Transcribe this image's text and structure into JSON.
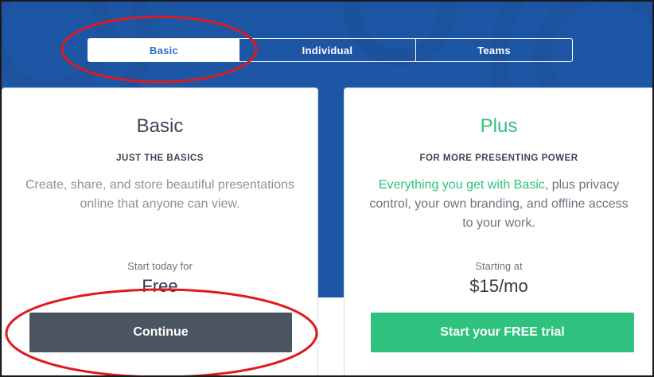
{
  "tabs": [
    {
      "label": "Basic",
      "active": true
    },
    {
      "label": "Individual",
      "active": false
    },
    {
      "label": "Teams",
      "active": false
    }
  ],
  "plans": {
    "basic": {
      "title": "Basic",
      "subtitle": "JUST THE BASICS",
      "description": "Create, share, and store beautiful presentations online that anyone can view.",
      "price_label": "Start today for",
      "price": "Free",
      "button_label": "Continue"
    },
    "plus": {
      "title": "Plus",
      "subtitle": "FOR MORE PRESENTING POWER",
      "description_highlight": "Everything you get with Basic",
      "description_rest": ", plus privacy control, your own branding, and offline access to your work.",
      "price_label": "Starting at",
      "price": "$15/mo",
      "button_label": "Start your FREE trial"
    }
  },
  "colors": {
    "hero_blue": "#1e56a6",
    "accent_green": "#2ec27e",
    "dark_button": "#4b5461",
    "annotation_red": "#e0191c"
  }
}
